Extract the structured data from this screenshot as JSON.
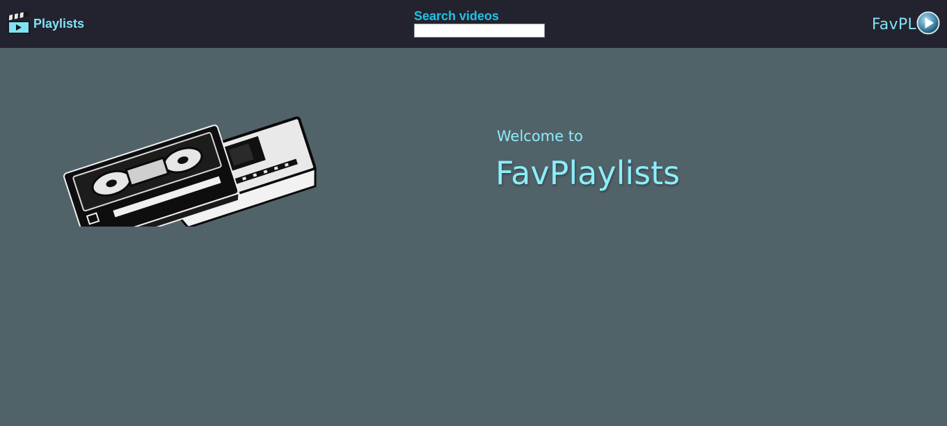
{
  "header": {
    "nav_playlists_label": "Playlists",
    "search_label": "Search videos",
    "search_value": "",
    "brand_label": "FavPL",
    "icons": {
      "playlists": "clapperboard-play-icon",
      "brand": "play-circle-icon"
    }
  },
  "main": {
    "welcome_text": "Welcome to",
    "title": "FavPlaylists",
    "hero_image": "vhs-cassette-illustration"
  },
  "colors": {
    "topbar": "#22232e",
    "background": "#526269",
    "accent": "#7fe3f5",
    "search_label": "#1dc4e8"
  }
}
